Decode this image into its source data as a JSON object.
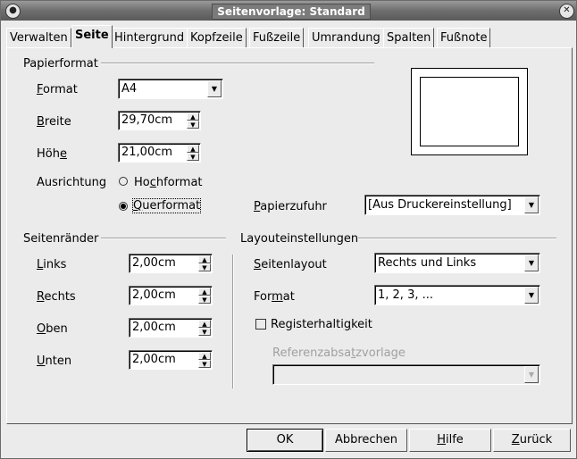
{
  "window": {
    "title": "Seitenvorlage: Standard",
    "left_button_icon": "window-menu-icon",
    "right_button_icon": "close-icon"
  },
  "tabs": [
    "Verwalten",
    "Seite",
    "Hintergrund",
    "Kopfzeile",
    "Fußzeile",
    "Umrandung",
    "Spalten",
    "Fußnote"
  ],
  "paper": {
    "group_title": "Papierformat",
    "format_label_u": "F",
    "format_label_rest": "ormat",
    "format_value": "A4",
    "width_label_u": "B",
    "width_label_rest": "reite",
    "width_value": "29,70cm",
    "height_label_pre": "Höh",
    "height_label_u": "e",
    "height_value": "21,00cm",
    "orientation_label": "Ausrichtung",
    "portrait_pre": "Ho",
    "portrait_u": "c",
    "portrait_rest": "hformat",
    "landscape_u": "Q",
    "landscape_rest": "uerformat",
    "orientation_selected": "Querformat",
    "tray_label_u": "P",
    "tray_label_rest": "apierzufuhr",
    "tray_value": "[Aus Druckereinstellung]"
  },
  "margins": {
    "group_title": "Seitenränder",
    "left_label_u": "L",
    "left_label_rest": "inks",
    "left_value": "2,00cm",
    "right_label_u": "R",
    "right_label_rest": "echts",
    "right_value": "2,00cm",
    "top_label_u": "O",
    "top_label_rest": "ben",
    "top_value": "2,00cm",
    "bottom_label_u": "U",
    "bottom_label_rest": "nten",
    "bottom_value": "2,00cm"
  },
  "layout": {
    "group_title": "Layouteinstellungen",
    "page_layout_label_u": "S",
    "page_layout_label_rest": "eitenlayout",
    "page_layout_value": "Rechts und Links",
    "format_label_pre": "For",
    "format_label_u": "m",
    "format_label_rest": "at",
    "format_value": "1, 2, 3, ...",
    "register_label_pre": "Registerhalti",
    "register_label_u": "g",
    "register_label_rest": "keit",
    "register_checked": false,
    "reference_label_pre": "Referenzabsa",
    "reference_label_u": "t",
    "reference_label_rest": "zvorlage",
    "reference_value": ""
  },
  "buttons": {
    "ok": "OK",
    "cancel": "Abbrechen",
    "help_u": "H",
    "help_rest": "ilfe",
    "back_u": "Z",
    "back_rest": "urück"
  }
}
